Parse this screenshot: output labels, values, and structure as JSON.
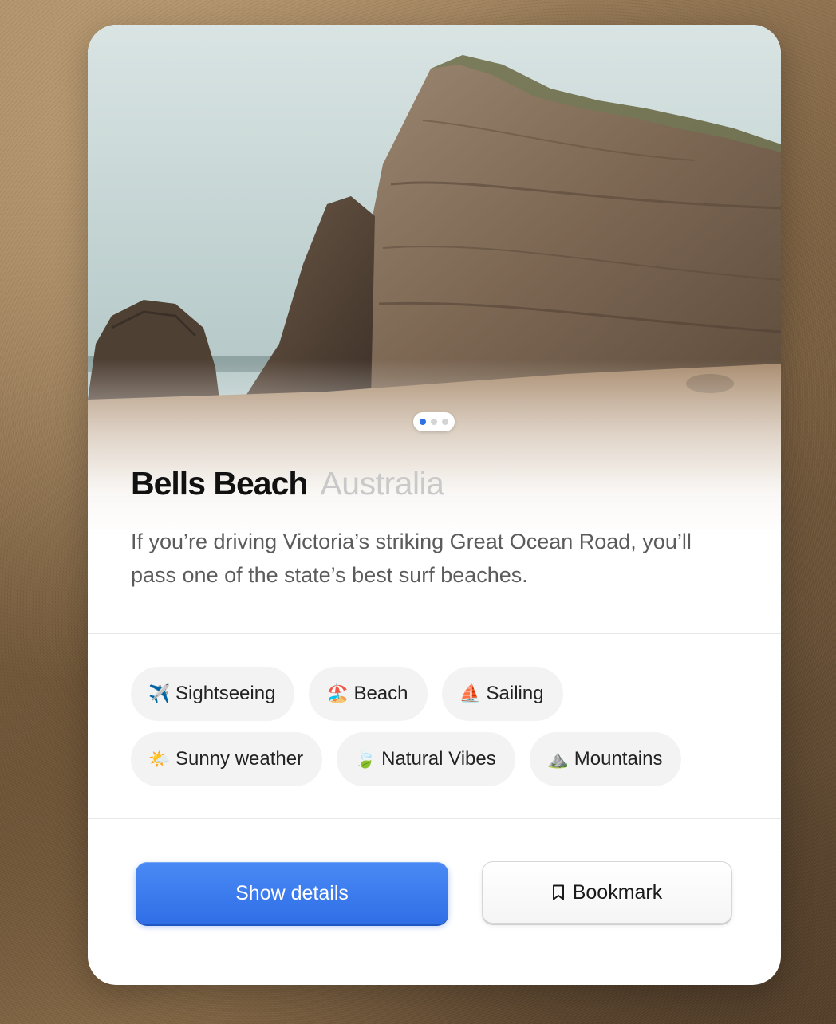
{
  "card": {
    "title": "Bells Beach",
    "location": "Australia",
    "description": {
      "before": "If you’re driving ",
      "link": "Victoria’s",
      "after": " striking Great Ocean Road, you’ll pass one of the state’s best surf beaches."
    },
    "carousel": {
      "slides": 3,
      "active_index": 1
    },
    "tags": [
      {
        "emoji": "✈️",
        "icon": "airplane-icon",
        "label": "Sightseeing"
      },
      {
        "emoji": "🏖️",
        "icon": "beach-umbrella-icon",
        "label": "Beach"
      },
      {
        "emoji": "⛵",
        "icon": "sailboat-icon",
        "label": "Sailing"
      },
      {
        "emoji": "🌤️",
        "icon": "sun-cloud-icon",
        "label": "Sunny weather"
      },
      {
        "emoji": "🍃",
        "icon": "leaf-icon",
        "label": "Natural Vibes"
      },
      {
        "emoji": "⛰️",
        "icon": "mountain-icon",
        "label": "Mountains"
      }
    ],
    "actions": {
      "primary_label": "Show details",
      "secondary_label": "Bookmark"
    }
  },
  "colors": {
    "accent": "#2f6fe8",
    "title": "#111111",
    "subtitle": "#c9c9c9",
    "body_text": "#5b5b5b",
    "tag_background": "#f3f3f3"
  }
}
